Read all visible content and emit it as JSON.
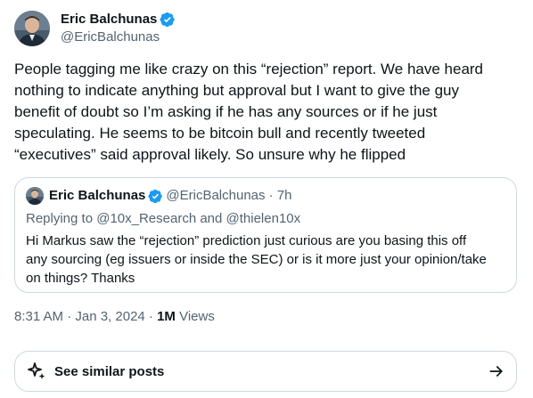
{
  "author": {
    "display_name": "Eric Balchunas",
    "handle": "@EricBalchunas",
    "avatar_icon": "avatar-photo",
    "verified_color": "#1d9bf0"
  },
  "tweet": {
    "text": "People tagging me like crazy on this “rejection” report. We have heard\nnothing to indicate anything but approval but I want to give the guy\nbenefit of doubt so I’m asking if he has any sources or if he just\nspeculating. He seems to be bitcoin bull and recently tweeted\n“executives” said approval likely. So unsure why he flipped"
  },
  "quote": {
    "display_name": "Eric Balchunas",
    "meta": "@EricBalchunas · 7h",
    "reply_line": "Replying to @10x_Research and @thielen10x",
    "text": "Hi Markus saw the “rejection” prediction just curious are you basing this off\nany sourcing (eg issuers or inside the SEC) or is it more just your opinion/take\non things? Thanks"
  },
  "meta": {
    "timestamp": "8:31 AM · Jan 3, 2024 · ",
    "views_count": "1M",
    "views_label": " Views"
  },
  "similar": {
    "label": "See similar posts",
    "icon": "sparkle-icon",
    "arrow_icon": "arrow-right-icon"
  }
}
